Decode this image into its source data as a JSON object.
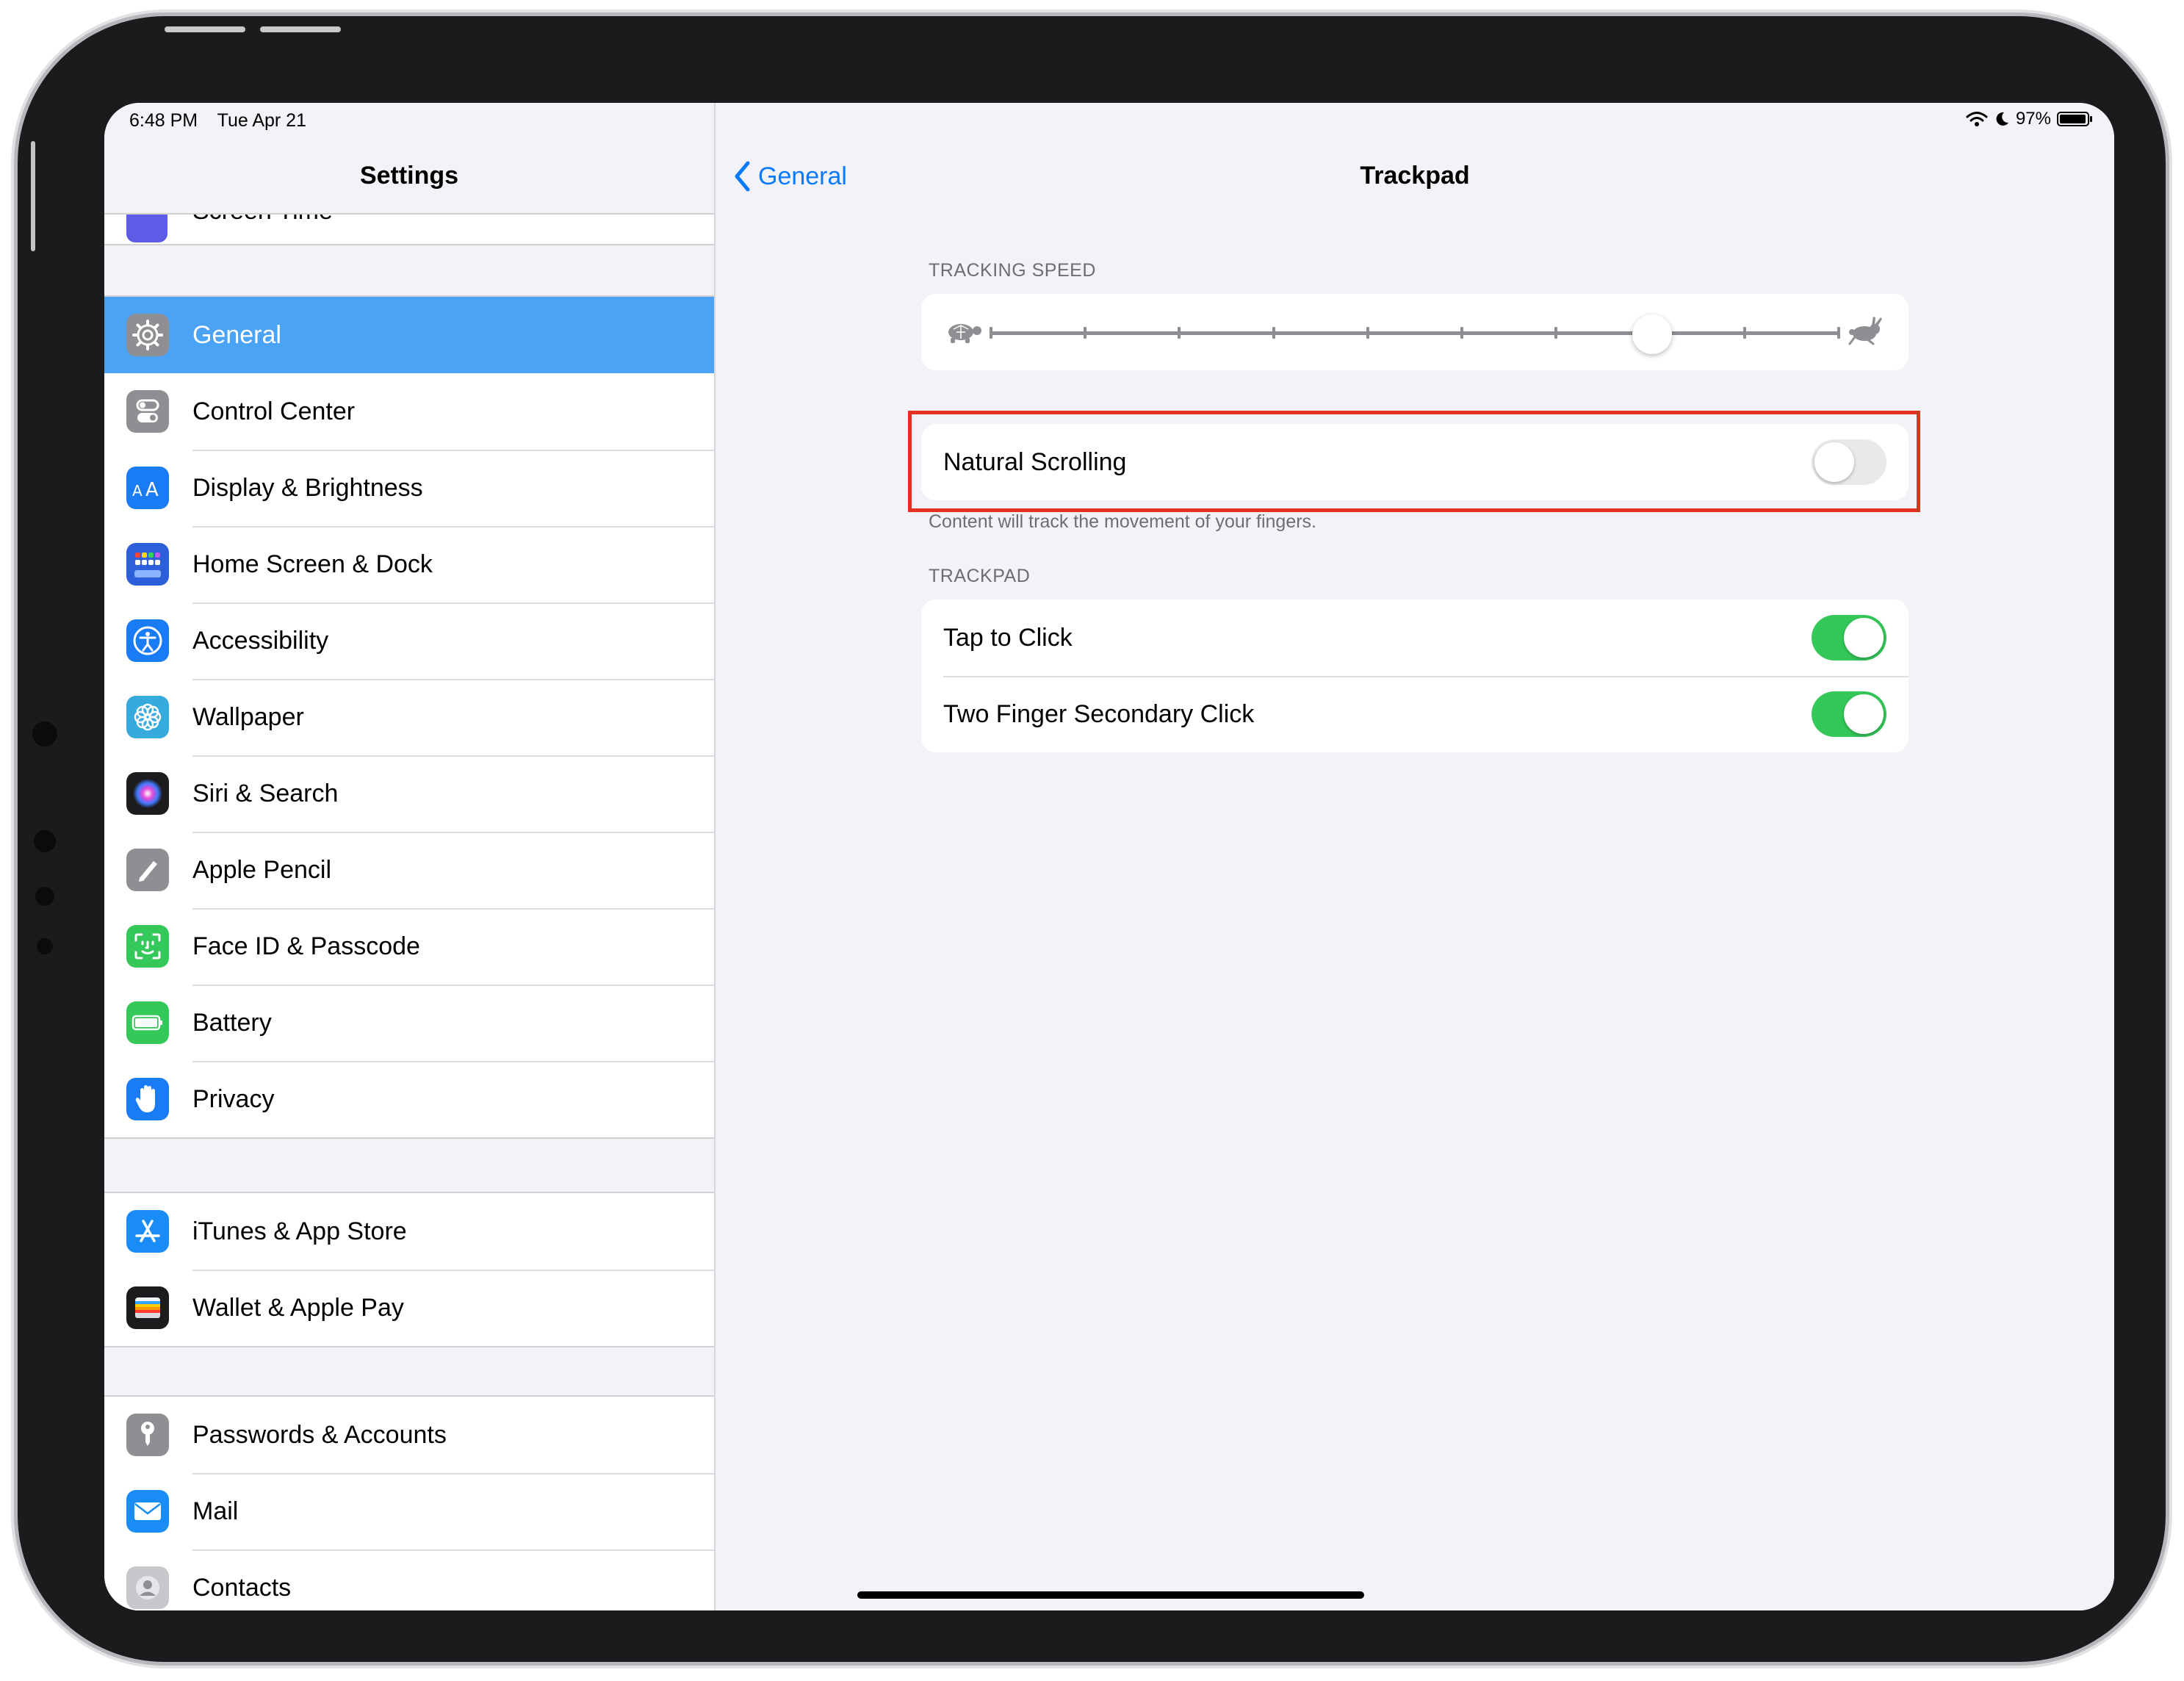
{
  "status_bar": {
    "time": "6:48 PM",
    "date": "Tue Apr 21",
    "battery_percent": "97%",
    "battery_level": 0.97
  },
  "sidebar": {
    "title": "Settings",
    "partial_item": "Screen Time",
    "groups": [
      {
        "items": [
          {
            "label": "General",
            "icon": "gear-icon",
            "color": "#8e8e93",
            "selected": true
          },
          {
            "label": "Control Center",
            "icon": "switches-icon",
            "color": "#8e8e93"
          },
          {
            "label": "Display & Brightness",
            "icon": "text-size-icon",
            "color": "#1a7cf5"
          },
          {
            "label": "Home Screen & Dock",
            "icon": "app-grid-icon",
            "color": "#2c5fd9"
          },
          {
            "label": "Accessibility",
            "icon": "accessibility-icon",
            "color": "#1a7cf5"
          },
          {
            "label": "Wallpaper",
            "icon": "flower-icon",
            "color": "#36aadc"
          },
          {
            "label": "Siri & Search",
            "icon": "siri-icon",
            "color": "#1c1c1e"
          },
          {
            "label": "Apple Pencil",
            "icon": "pencil-icon",
            "color": "#8e8e93"
          },
          {
            "label": "Face ID & Passcode",
            "icon": "face-id-icon",
            "color": "#34c759"
          },
          {
            "label": "Battery",
            "icon": "battery-icon",
            "color": "#34c759"
          },
          {
            "label": "Privacy",
            "icon": "hand-icon",
            "color": "#1a7cf5"
          }
        ]
      },
      {
        "items": [
          {
            "label": "iTunes & App Store",
            "icon": "app-store-icon",
            "color": "#1a8cf5"
          },
          {
            "label": "Wallet & Apple Pay",
            "icon": "wallet-icon",
            "color": "#1c1c1e"
          }
        ]
      },
      {
        "items": [
          {
            "label": "Passwords & Accounts",
            "icon": "key-icon",
            "color": "#8e8e93"
          },
          {
            "label": "Mail",
            "icon": "envelope-icon",
            "color": "#1a8cf5"
          },
          {
            "label": "Contacts",
            "icon": "contacts-icon",
            "color": "#c7c7cc"
          }
        ]
      }
    ]
  },
  "detail": {
    "back_label": "General",
    "title": "Trackpad",
    "tracking_speed": {
      "section_label": "TRACKING SPEED",
      "tick_count": 10,
      "value": 0.78
    },
    "natural_scrolling": {
      "label": "Natural Scrolling",
      "on": false,
      "footer": "Content will track the movement of your fingers."
    },
    "trackpad": {
      "section_label": "TRACKPAD",
      "rows": [
        {
          "label": "Tap to Click",
          "on": true
        },
        {
          "label": "Two Finger Secondary Click",
          "on": true
        }
      ]
    }
  },
  "colors": {
    "accent": "#0a7aff",
    "selected_row": "#4ba3f5",
    "toggle_on": "#34c759",
    "highlight": "#e2321f"
  }
}
